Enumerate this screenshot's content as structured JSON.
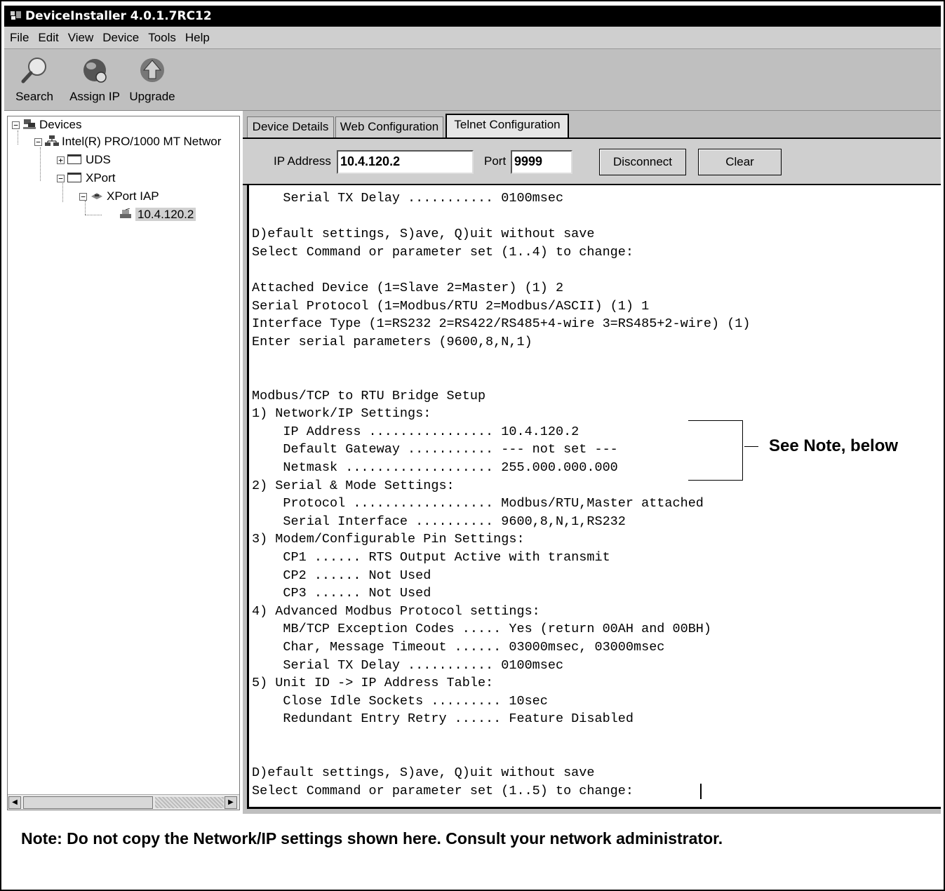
{
  "window": {
    "title": "DeviceInstaller 4.0.1.7RC12"
  },
  "menu": [
    "File",
    "Edit",
    "View",
    "Device",
    "Tools",
    "Help"
  ],
  "toolbar": {
    "search": "Search",
    "assign_ip": "Assign IP",
    "upgrade": "Upgrade"
  },
  "tree": {
    "root": "Devices",
    "adapter": "Intel(R) PRO/1000 MT Networ",
    "uds": "UDS",
    "xport": "XPort",
    "xport_iap": "XPort IAP",
    "device_ip": "10.4.120.2"
  },
  "tabs": [
    "Device Details",
    "Web Configuration",
    "Telnet Configuration"
  ],
  "connection": {
    "ip_label": "IP Address",
    "ip_value": "10.4.120.2",
    "port_label": "Port",
    "port_value": "9999",
    "disconnect": "Disconnect",
    "clear": "Clear"
  },
  "terminal": [
    "    Serial TX Delay ........... 0100msec",
    "",
    "D)efault settings, S)ave, Q)uit without save",
    "Select Command or parameter set (1..4) to change:",
    "",
    "Attached Device (1=Slave 2=Master) (1) 2",
    "Serial Protocol (1=Modbus/RTU 2=Modbus/ASCII) (1) 1",
    "Interface Type (1=RS232 2=RS422/RS485+4-wire 3=RS485+2-wire) (1)",
    "Enter serial parameters (9600,8,N,1)",
    "",
    "",
    "Modbus/TCP to RTU Bridge Setup",
    "1) Network/IP Settings:",
    "    IP Address ................ 10.4.120.2",
    "    Default Gateway ........... --- not set ---",
    "    Netmask ................... 255.000.000.000",
    "2) Serial & Mode Settings:",
    "    Protocol .................. Modbus/RTU,Master attached",
    "    Serial Interface .......... 9600,8,N,1,RS232",
    "3) Modem/Configurable Pin Settings:",
    "    CP1 ...... RTS Output Active with transmit",
    "    CP2 ...... Not Used",
    "    CP3 ...... Not Used",
    "4) Advanced Modbus Protocol settings:",
    "    MB/TCP Exception Codes ..... Yes (return 00AH and 00BH)",
    "    Char, Message Timeout ...... 03000msec, 03000msec",
    "    Serial TX Delay ........... 0100msec",
    "5) Unit ID -> IP Address Table:",
    "    Close Idle Sockets ......... 10sec",
    "    Redundant Entry Retry ...... Feature Disabled",
    "",
    "",
    "D)efault settings, S)ave, Q)uit without save",
    "Select Command or parameter set (1..5) to change: "
  ],
  "callout": "See Note, below",
  "footnote": "Note: Do not copy the Network/IP settings shown here.  Consult your network administrator.",
  "colors": {
    "titlebar": "#000000",
    "chrome": "#bfbfbf",
    "terminal_bg": "#ffffff"
  },
  "icons": [
    "app-icon",
    "search-icon",
    "assign-ip-icon",
    "upgrade-icon",
    "devices-icon",
    "network-adapter-icon",
    "folder-icon",
    "xport-iap-icon",
    "device-icon"
  ]
}
